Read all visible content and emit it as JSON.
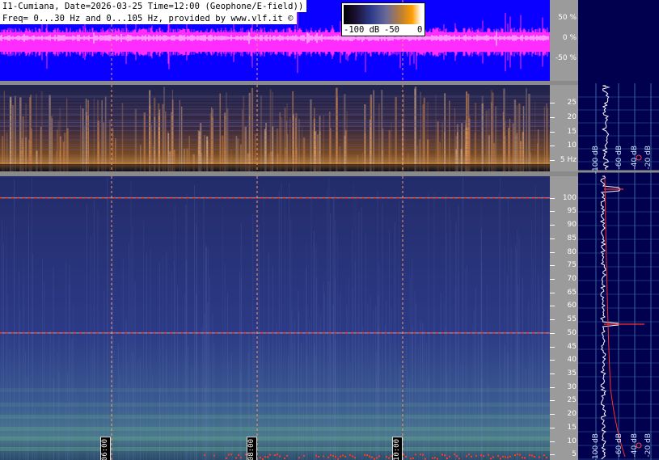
{
  "title_line1": "I1-Cumiana, Date=2026-03-25 Time=12:00 (Geophone/E-field))",
  "title_line2": "Freq= 0...30 Hz and 0...105 Hz, provided by www.vlf.it ©",
  "colorbar": {
    "labels": [
      "-100 dB",
      "-50",
      "0"
    ]
  },
  "waveform_scale": [
    "50 %",
    "0 %",
    "-50 %"
  ],
  "spec1_ticks": [
    "25",
    "20",
    "15",
    "10",
    "5 Hz"
  ],
  "spec1_tick_values": [
    25,
    20,
    15,
    10,
    5
  ],
  "spec2_ticks": [
    "100",
    "95",
    "90",
    "85",
    "80",
    "75",
    "70",
    "65",
    "60",
    "55",
    "50",
    "45",
    "40",
    "35",
    "30",
    "25",
    "20",
    "15",
    "10",
    "5"
  ],
  "spec2_tick_values": [
    100,
    95,
    90,
    85,
    80,
    75,
    70,
    65,
    60,
    55,
    50,
    45,
    40,
    35,
    30,
    25,
    20,
    15,
    10,
    5
  ],
  "time_markers": [
    "06:00",
    "08:00",
    "10:00"
  ],
  "profile_labels_top": [
    "-100 dB",
    "-60 dB",
    "-40 dB",
    "-20 dB"
  ],
  "profile_labels_bottom": [
    "-100 dB",
    "-60 dB",
    "-40 dB",
    "-20 dB"
  ],
  "colors": {
    "wave_bg": "#0a00ff",
    "wave_trace": "#ff2cff",
    "profile_bg": "#00004f",
    "hum_line": "#ff3a1a"
  }
}
